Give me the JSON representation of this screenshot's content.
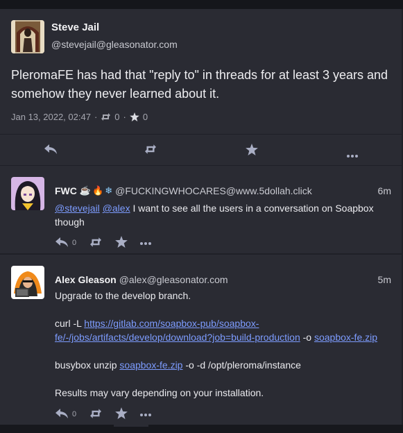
{
  "main": {
    "author_name": "Steve Jail",
    "author_handle": "@stevejail@gleasonator.com",
    "text": "PleromaFE has had that \"reply to\" in threads for at least 3 years and somehow they never learned about it.",
    "timestamp": "Jan 13, 2022, 02:47",
    "reblog_count": "0",
    "favourite_count": "0",
    "actions": [
      "reply-icon",
      "reblog-icon",
      "star-icon",
      "ellipsis-icon"
    ]
  },
  "replies": [
    {
      "author_name": "FWC",
      "emojis": [
        "☕",
        "🔥",
        "❄"
      ],
      "author_handle": "@FUCKINGWHOCARES@www.5dollah.click",
      "time": "6m",
      "mention1": "@stevejail",
      "mention2": "@alex",
      "text": " I want to see all the users in a conversation on Soapbox though",
      "reply_count": "0"
    },
    {
      "author_name": "Alex Gleason",
      "author_handle": "@alex@gleasonator.com",
      "time": "5m",
      "line1": "Upgrade to the develop branch.",
      "curl_prefix": "curl -L ",
      "curl_link": "https://gitlab.com/soapbox-pub/soapbox-fe/-/jobs/artifacts/develop/download?job=build-production",
      "curl_mid": " -o ",
      "curl_file": "soapbox-fe.zip",
      "unzip_prefix": "busybox unzip ",
      "unzip_file": "soapbox-fe.zip",
      "unzip_suffix": " -o -d /opt/pleroma/instance",
      "line4": "Results may vary depending on your installation.",
      "reply_count": "0"
    }
  ],
  "colors": {
    "background": "#1d1e24",
    "card": "#2a2b33",
    "link": "#7d9cff",
    "icon": "#a9aec4"
  }
}
